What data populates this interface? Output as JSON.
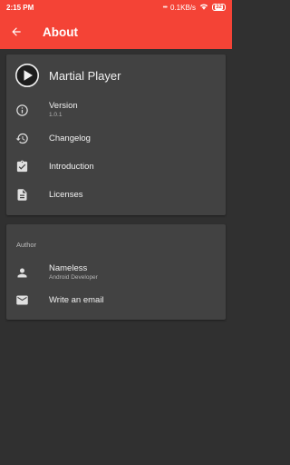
{
  "status_bar": {
    "time": "2:15 PM",
    "dots": "•••",
    "network_speed": "0.1KB/s",
    "battery_level": "32"
  },
  "app_bar": {
    "title": "About",
    "back_icon": "arrow-back-icon"
  },
  "app_card": {
    "app_name": "Martial Player",
    "items": [
      {
        "label": "Version",
        "sub": "1.0.1",
        "icon": "info-icon"
      },
      {
        "label": "Changelog",
        "icon": "history-icon"
      },
      {
        "label": "Introduction",
        "icon": "assignment-check-icon"
      },
      {
        "label": "Licenses",
        "icon": "description-icon"
      }
    ]
  },
  "author_card": {
    "header": "Author",
    "items": [
      {
        "label": "Nameless",
        "sub": "Android Developer",
        "icon": "person-icon"
      },
      {
        "label": "Write an email",
        "icon": "email-icon"
      }
    ]
  },
  "colors": {
    "primary": "#f44336",
    "background": "#303030",
    "card": "#424242",
    "text": "#f1f1f1",
    "icon": "#e0e0e0"
  }
}
